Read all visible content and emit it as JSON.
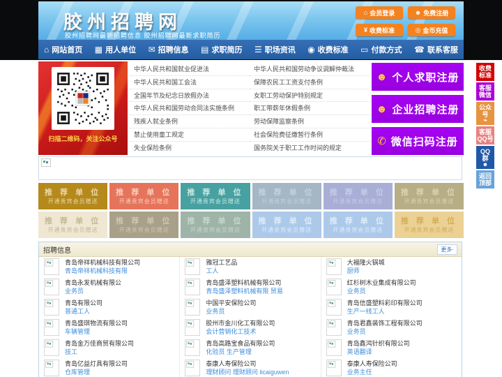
{
  "header": {
    "title": "胶州招聘网",
    "subtitle": "胶州招聘网最新招聘信息  胶州招聘网最新求职简历",
    "top_buttons": [
      {
        "name": "member-login-button",
        "icon": "home-icon",
        "glyph": "⌂",
        "label": "会员登录"
      },
      {
        "name": "free-register-button",
        "icon": "user-icon",
        "glyph": "☻",
        "label": "免费注册"
      },
      {
        "name": "fee-standard-button",
        "icon": "yen-icon",
        "glyph": "¥",
        "label": "收费标准"
      },
      {
        "name": "coin-recharge-button",
        "icon": "coins-icon",
        "glyph": "◎",
        "label": "金币充值"
      }
    ]
  },
  "nav": {
    "items": [
      {
        "name": "nav-item-home",
        "icon": "home-icon",
        "glyph": "⌂",
        "label": "网站首页"
      },
      {
        "name": "nav-item-employers",
        "icon": "building-icon",
        "glyph": "▦",
        "label": "用人单位"
      },
      {
        "name": "nav-item-jobs",
        "icon": "chat-bubble-icon",
        "glyph": "✉",
        "label": "招聘信息"
      },
      {
        "name": "nav-item-resumes",
        "icon": "resume-icon",
        "glyph": "▤",
        "label": "求职简历"
      },
      {
        "name": "nav-item-news",
        "icon": "news-list-icon",
        "glyph": "☰",
        "label": "职场资讯"
      },
      {
        "name": "nav-item-fees",
        "icon": "price-icon",
        "glyph": "◉",
        "label": "收费标准"
      },
      {
        "name": "nav-item-payment",
        "icon": "bank-card-icon",
        "glyph": "▭",
        "label": "付款方式"
      },
      {
        "name": "nav-item-service",
        "icon": "phone-icon",
        "glyph": "☎",
        "label": "联系客服"
      }
    ]
  },
  "qr_panel": {
    "caption": "扫描二维码，关注公众号"
  },
  "laws": {
    "left": [
      "中华人民共和国就业促进法",
      "中华人民共和国工会法",
      "全国年节及纪念日放假办法",
      "中华人民共和国劳动合同法实施条例",
      "残疾人就业条例",
      "禁止使用童工规定",
      "失业保险条例"
    ],
    "right": [
      "中华人民共和国劳动争议调解仲裁法",
      "保障农民工工资支付条例",
      "女职工劳动保护特别规定",
      "职工带薪年休假条例",
      "劳动保障监察条例",
      "社会保险费征缴暂行条例",
      "国务院关于职工工作时间的规定"
    ]
  },
  "register_buttons": [
    {
      "name": "personal-register-button",
      "icon": "person-add-icon",
      "glyph": "☻",
      "label": "个人求职注册"
    },
    {
      "name": "company-register-button",
      "icon": "person-briefcase-icon",
      "glyph": "☻",
      "label": "企业招聘注册"
    },
    {
      "name": "wechat-register-button",
      "icon": "wechat-icon",
      "glyph": "✆",
      "label": "微信扫码注册"
    }
  ],
  "side_widgets": [
    {
      "name": "widget-fee-standard",
      "label": "收费\n标准",
      "bg": "#d50000"
    },
    {
      "name": "widget-service-wechat",
      "label": "客服\n微信",
      "bg": "#ab00d5"
    },
    {
      "name": "widget-official-account",
      "label": "公众\n号",
      "bg": "#e69440",
      "icon": "wechat-mini-icon",
      "glyph": "❧"
    },
    {
      "name": "widget-service-qq",
      "label": "客服\nQQ号",
      "bg": "#e98181"
    },
    {
      "name": "widget-qq-group",
      "label": "QQ\n群",
      "bg": "#2058a8",
      "icon": "qq-penguin-icon",
      "glyph": "☻"
    },
    {
      "name": "widget-back-to-top",
      "label": "返回\n顶部",
      "bg": "#66a3d9"
    }
  ],
  "promo": {
    "title": "推 荐 单 位",
    "subtitle": "开通贵宾会员赠送",
    "rows": [
      [
        {
          "bg": "#b5891b",
          "fg": "#ead9a8"
        },
        {
          "bg": "#e5745b",
          "fg": "#f6d0bf"
        },
        {
          "bg": "#47a1a1",
          "fg": "#cfe7e5"
        },
        {
          "bg": "#a5b6c5",
          "fg": "#c3d2dd"
        },
        {
          "bg": "#a9aed7",
          "fg": "#c6cbe6"
        },
        {
          "bg": "#b7ae85",
          "fg": "#d9d3b3"
        }
      ],
      [
        {
          "bg": "#efe7d2",
          "fg": "#c2b897"
        },
        {
          "bg": "#a8a089",
          "fg": "#cec7ae"
        },
        {
          "bg": "#9fb4a8",
          "fg": "#c8d6cc"
        },
        {
          "bg": "#adc9ea",
          "fg": "#dfecfa"
        },
        {
          "bg": "#adc9ea",
          "fg": "#dfecfa"
        },
        {
          "bg": "#ecd195",
          "fg": "#d3ad57"
        }
      ]
    ]
  },
  "jobs": {
    "section_title": "招聘信息",
    "more_label": "更多·",
    "columns": [
      [
        {
          "company": "青岛帝祥机械科技有限公司",
          "position": "青岛帝祥机械科技有限"
        },
        {
          "company": "青岛永发机械有限公",
          "position": "业务员"
        },
        {
          "company": "青岛有限公司",
          "position": "普通工人"
        },
        {
          "company": "青岛盛琪物流有限公司",
          "position": "车辆管理"
        },
        {
          "company": "青岛金万佳商贸有限公司",
          "position": "技工"
        },
        {
          "company": "青岛亿益灯具有限公司",
          "position": "仓库管理"
        }
      ],
      [
        {
          "company": "雅冠工艺品",
          "position": "工人"
        },
        {
          "company": "青岛盛泽塑料机械有限公司",
          "position": "青岛盛泽塑料机械有限 贸易"
        },
        {
          "company": "中国平安保险公司",
          "position": "业务员"
        },
        {
          "company": "胶州市金川化工有限公司",
          "position": "会计营销化工技术"
        },
        {
          "company": "青岛高路宝食品有限公司",
          "position": "化验员 生产管理"
        },
        {
          "company": "泰康人寿保险公司",
          "position": "理财顾问 理财顾问 licaiguwen"
        }
      ],
      [
        {
          "company": "大福隆火锅城",
          "position": "厨师"
        },
        {
          "company": "红杉树木业集成有限公司",
          "position": "业务员"
        },
        {
          "company": "青岛信盛塑料彩印有限公司",
          "position": "生产一线工人"
        },
        {
          "company": "青岛君鑫装饰工程有限公司",
          "position": "业务员"
        },
        {
          "company": "青岛鑫鸿针织有限公司",
          "position": "英语翻译"
        },
        {
          "company": "泰康人寿保险公司",
          "position": "业务主任"
        }
      ]
    ]
  },
  "colors": {
    "nav_blue": "#2b65ac",
    "button_orange": "#f5821f",
    "register_purple": "#9900e0",
    "banner_red": "#cb1a1a",
    "link_blue": "#3e8edd"
  }
}
